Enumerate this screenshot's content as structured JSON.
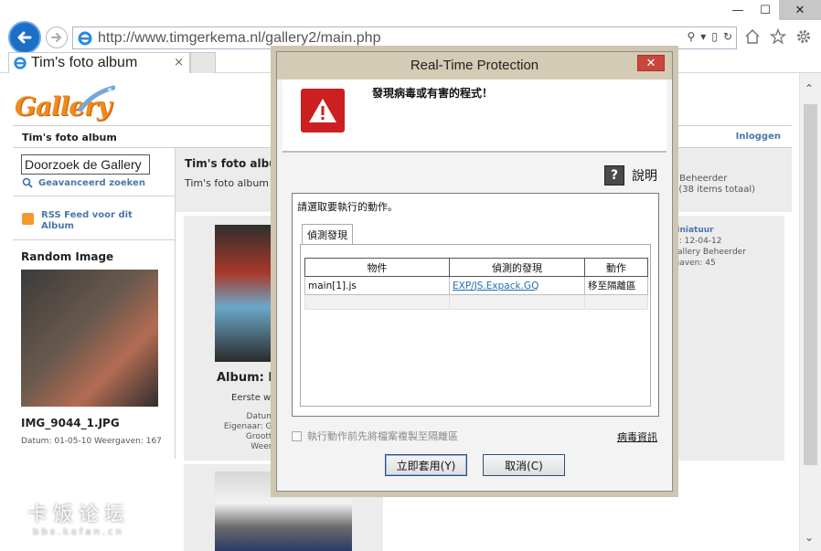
{
  "browser": {
    "url": "http://www.timgerkema.nl/gallery2/main.php",
    "tab_title": "Tim's foto album",
    "tab_close": "×",
    "win_minimize": "—",
    "win_maximize": "☐",
    "win_close": "✕"
  },
  "page": {
    "logo_text": "Gallery",
    "album_bar_title": "Tim's foto album",
    "login": "Inloggen",
    "search_placeholder": "Doorzoek de Gallery",
    "advanced_search": "Geavanceerd zoeken",
    "rss_feed": "RSS Feed voor dit",
    "rss_feed_line2": "Album",
    "random_title": "Random Image",
    "random_name": "IMG_9044_1.JPG",
    "random_meta": "Datum: 01-05-10 Weergaven: 167",
    "main_title": "Tim's foto album",
    "main_sub": "Tim's foto album",
    "right_info": [
      "0",
      "y Beheerder",
      "s (38 items totaal)"
    ],
    "album_label": "Album: E",
    "album_sub": "Eerste we",
    "album_meta": [
      "Datum:",
      "Eigenaar: Ga",
      "Grootte",
      "Weerg"
    ],
    "right_cell": {
      "title": "niniatuur",
      "lines": [
        "m: 12-04-12",
        "Gallery Beheerder",
        "rgaven: 45"
      ]
    },
    "watermark_big": "卡饭论坛",
    "watermark_small": "bbs.kafan.cn"
  },
  "dialog": {
    "title": "Real-Time Protection",
    "close": "✕",
    "headline": "發現病毒或有害的程式！",
    "help": "說明",
    "prompt": "請選取要執行的動作。",
    "tab_label": "偵測發現",
    "table": {
      "headers": [
        "物件",
        "偵測的發現",
        "動作"
      ],
      "rows": [
        {
          "object": "main[1].js",
          "detection": "EXP/JS.Expack.GQ",
          "action": "移至隔離區"
        }
      ]
    },
    "copy_checkbox": "執行動作前先將檔案複製至隔離區",
    "virus_info": "病毒資訊",
    "apply_button": "立即套用(Y)",
    "cancel_button": "取消(C)"
  },
  "colors": {
    "browser_accent": "#1c6fc7",
    "gallery_orange": "#f08a1a",
    "link_blue": "#4b77a8",
    "dialog_title_bg": "#d4cbb4",
    "warning_red": "#cc1f1f"
  },
  "icons": [
    "back-arrow-icon",
    "forward-arrow-icon",
    "ie-logo-icon",
    "search-icon",
    "refresh-icon",
    "home-icon",
    "star-icon",
    "gear-icon",
    "rss-icon",
    "warning-icon",
    "help-icon"
  ]
}
